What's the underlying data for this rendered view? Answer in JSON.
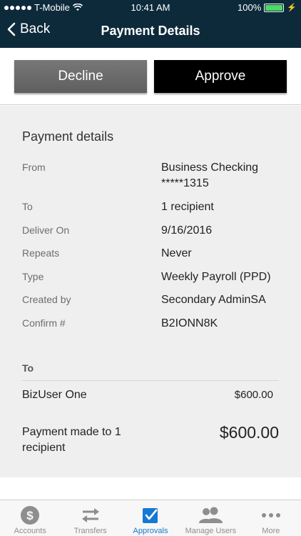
{
  "status_bar": {
    "carrier": "T-Mobile",
    "time": "10:41 AM",
    "battery": "100%"
  },
  "nav": {
    "back_label": "Back",
    "title": "Payment Details"
  },
  "actions": {
    "decline_label": "Decline",
    "approve_label": "Approve"
  },
  "details": {
    "title": "Payment details",
    "rows": [
      {
        "label": "From",
        "value": "Business Checking",
        "value2": "*****1315"
      },
      {
        "label": "To",
        "value": "1 recipient"
      },
      {
        "label": "Deliver On",
        "value": "9/16/2016"
      },
      {
        "label": "Repeats",
        "value": "Never"
      },
      {
        "label": "Type",
        "value": "Weekly Payroll (PPD)"
      },
      {
        "label": "Created by",
        "value": "Secondary AdminSA"
      },
      {
        "label": "Confirm #",
        "value": "B2IONN8K"
      }
    ]
  },
  "recipients": {
    "header": "To",
    "items": [
      {
        "name": "BizUser One",
        "amount": "$600.00"
      }
    ]
  },
  "summary": {
    "text": "Payment made to 1 recipient",
    "amount": "$600.00"
  },
  "tabs": [
    {
      "label": "Accounts",
      "icon": "dollar-circle-icon",
      "active": false
    },
    {
      "label": "Transfers",
      "icon": "transfer-arrows-icon",
      "active": false
    },
    {
      "label": "Approvals",
      "icon": "checkbox-icon",
      "active": true
    },
    {
      "label": "Manage Users",
      "icon": "users-icon",
      "active": false
    },
    {
      "label": "More",
      "icon": "more-dots-icon",
      "active": false
    }
  ],
  "colors": {
    "nav_bg": "#0d2a3b",
    "active_tab": "#1478d4",
    "approve_bg": "#000000",
    "decline_bg": "#666666"
  }
}
